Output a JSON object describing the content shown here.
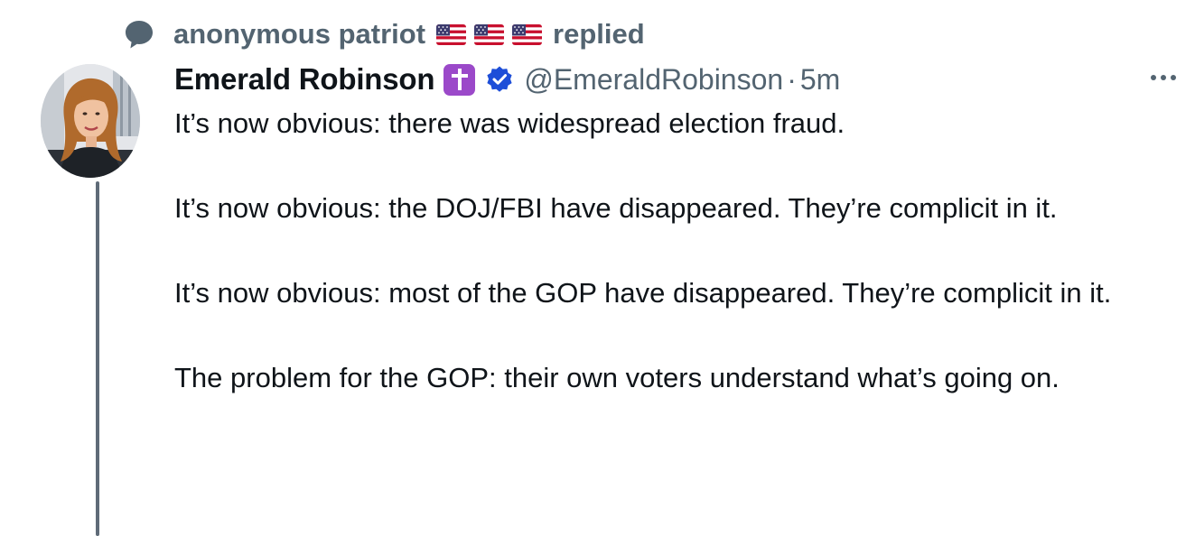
{
  "social_context": {
    "actor_name": "anonymous patriot",
    "flags": [
      "us-flag",
      "us-flag",
      "us-flag"
    ],
    "action": "replied",
    "icon": "reply-bubble-icon"
  },
  "tweet": {
    "author": {
      "display_name": "Emerald Robinson",
      "badge_icon": "latin-cross-icon",
      "verified_icon": "verified-badge-icon",
      "handle": "@EmeraldRobinson",
      "separator": "·",
      "timestamp": "5m"
    },
    "more_label": "···",
    "paragraphs": [
      "It’s now obvious: there was widespread election fraud.",
      "It’s now obvious: the DOJ/FBI have disappeared. They’re complicit in it.",
      "It’s now obvious: most of the GOP have disappeared. They’re complicit in it.",
      "The problem for the GOP: their own voters understand what’s going on."
    ]
  },
  "colors": {
    "text_primary": "#0f1419",
    "text_secondary": "#536471",
    "verified_blue": "#1d4ed8",
    "cross_badge": "#9b49c9",
    "thread_line": "#5f6b78"
  }
}
